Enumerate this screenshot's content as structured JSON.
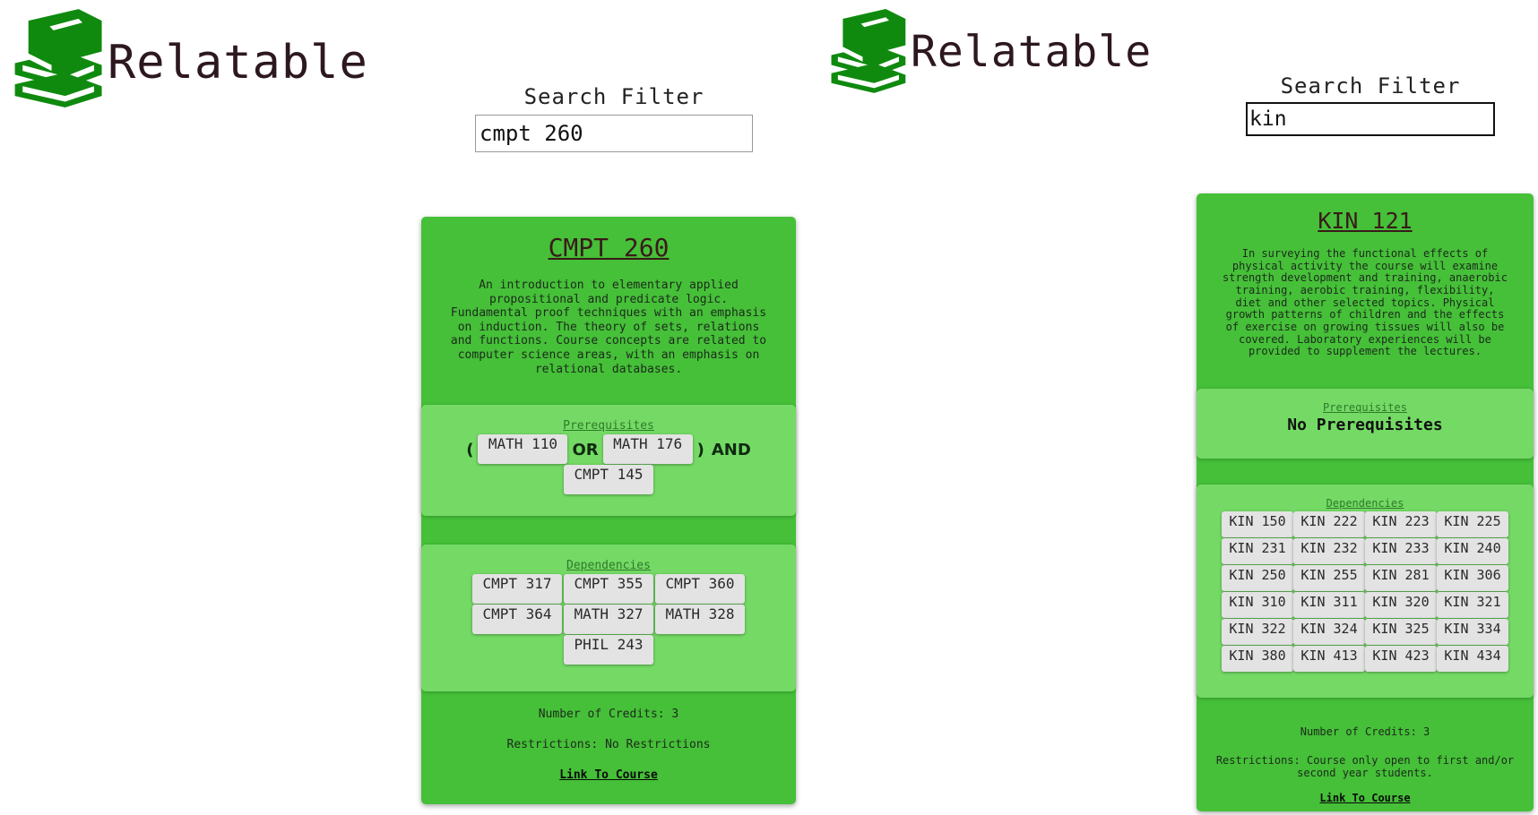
{
  "left": {
    "app_name": "Relatable",
    "search": {
      "label": "Search Filter",
      "value": "cmpt 260"
    },
    "card": {
      "title": "CMPT 260",
      "description": "An introduction to elementary applied propositional and predicate logic. Fundamental proof techniques with an emphasis on induction. The theory of sets, relations and functions. Course concepts are related to computer science areas, with an emphasis on relational databases.",
      "prereq_label": "Prerequisites",
      "prereq": {
        "open_paren": "(",
        "course_a": "MATH 110",
        "or_op": "OR",
        "course_b": "MATH 176",
        "close_paren": ")",
        "and_op": "AND",
        "course_c": "CMPT 145"
      },
      "deps_label": "Dependencies",
      "dependencies": [
        "CMPT 317",
        "CMPT 355",
        "CMPT 360",
        "CMPT 364",
        "MATH 327",
        "MATH 328",
        "PHIL 243"
      ],
      "credits": "Number of Credits: 3",
      "restrictions": "Restrictions: No Restrictions",
      "link": "Link To Course"
    }
  },
  "right": {
    "app_name": "Relatable",
    "search": {
      "label": "Search Filter",
      "value": "kin"
    },
    "card": {
      "title": "KIN 121",
      "description": "In surveying the functional effects of physical activity the course will examine strength development and training, anaerobic training, aerobic training, flexibility, diet and other selected topics. Physical growth patterns of children and the effects of exercise on growing tissues will also be covered. Laboratory experiences will be provided to supplement the lectures.",
      "prereq_label": "Prerequisites",
      "no_prereq": "No Prerequisites",
      "deps_label": "Dependencies",
      "dependencies": [
        "KIN 150",
        "KIN 222",
        "KIN 223",
        "KIN 225",
        "KIN 231",
        "KIN 232",
        "KIN 233",
        "KIN 240",
        "KIN 250",
        "KIN 255",
        "KIN 281",
        "KIN 306",
        "KIN 310",
        "KIN 311",
        "KIN 320",
        "KIN 321",
        "KIN 322",
        "KIN 324",
        "KIN 325",
        "KIN 334",
        "KIN 380",
        "KIN 413",
        "KIN 423",
        "KIN 434"
      ],
      "credits": "Number of Credits: 3",
      "restrictions": "Restrictions: Course only open to first and/or second year students.",
      "link": "Link To Course"
    }
  },
  "colors": {
    "card": "#45c038",
    "panel": "#74da65",
    "logo": "#0f8a0f",
    "chip": "#e3e3e3"
  },
  "icons": {
    "logo": "books-icon"
  }
}
